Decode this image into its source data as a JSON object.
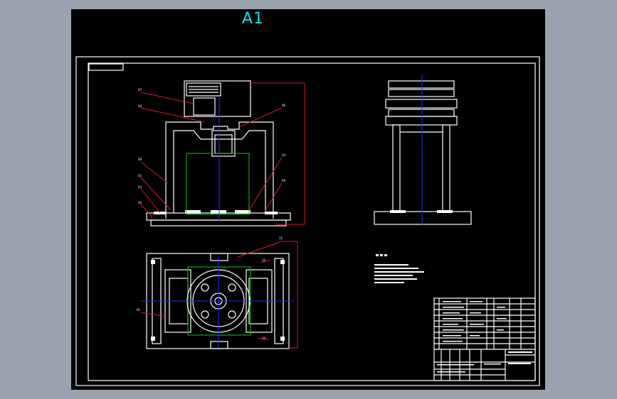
{
  "sheet": {
    "size_label": "A1"
  },
  "colors": {
    "background": "#9aa3ad",
    "canvas": "#000000",
    "title": "#00e5e5",
    "outline": "#ffffff",
    "leader": "#e0152a",
    "centerline": "#2030ff",
    "workpiece": "#18c418"
  }
}
